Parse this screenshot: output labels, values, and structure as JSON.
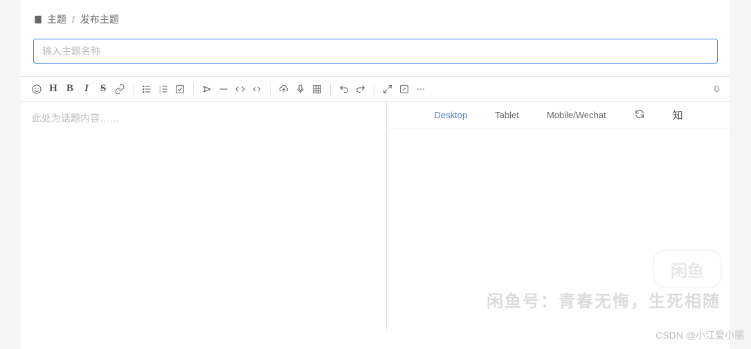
{
  "breadcrumb": {
    "root": "主题",
    "current": "发布主题",
    "sep": "/"
  },
  "title_input": {
    "placeholder": "输入主题名称",
    "value": ""
  },
  "toolbar": {
    "heading": "H",
    "bold": "B",
    "italic": "I",
    "strike": "S",
    "counter": "0"
  },
  "editor": {
    "placeholder": "此处为话题内容……"
  },
  "preview": {
    "desktop": "Desktop",
    "tablet": "Tablet",
    "mobile": "Mobile/Wechat",
    "zhi": "知"
  },
  "watermark": {
    "box": "闲鱼",
    "line": "闲鱼号：青春无悔，生死相随",
    "csdn": "CSDN @小江爱小丽"
  }
}
